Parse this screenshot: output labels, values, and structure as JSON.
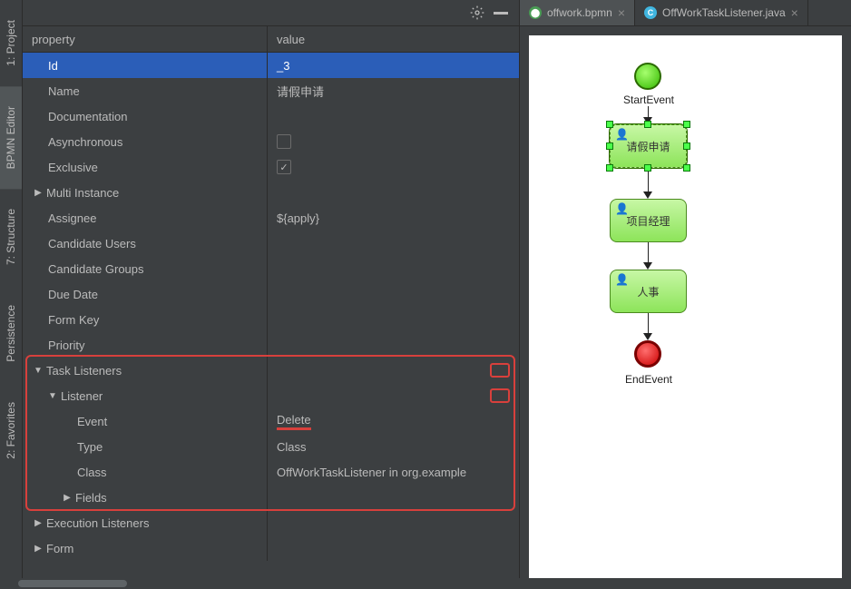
{
  "toolstrip": {
    "items": [
      {
        "label": "1: Project"
      },
      {
        "label": "BPMN Editor"
      },
      {
        "label": "7: Structure"
      },
      {
        "label": "Persistence"
      },
      {
        "label": "2: Favorites"
      }
    ]
  },
  "props": {
    "header_property": "property",
    "header_value": "value",
    "rows": {
      "id_label": "Id",
      "id_value": "_3",
      "name_label": "Name",
      "name_value": "请假申请",
      "doc_label": "Documentation",
      "async_label": "Asynchronous",
      "excl_label": "Exclusive",
      "excl_checked": "✓",
      "multi_label": "Multi Instance",
      "assignee_label": "Assignee",
      "assignee_value": "${apply}",
      "cand_users_label": "Candidate Users",
      "cand_groups_label": "Candidate Groups",
      "due_label": "Due Date",
      "formkey_label": "Form Key",
      "priority_label": "Priority",
      "tasklisteners_label": "Task Listeners",
      "listener_label": "Listener",
      "event_label": "Event",
      "event_value": "Delete",
      "type_label": "Type",
      "type_value": "Class",
      "class_label": "Class",
      "class_value": "OffWorkTaskListener in org.example",
      "fields_label": "Fields",
      "execlisteners_label": "Execution Listeners",
      "form_label": "Form"
    }
  },
  "tabs": {
    "items": [
      {
        "label": "offwork.bpmn"
      },
      {
        "label": "OffWorkTaskListener.java"
      }
    ]
  },
  "diagram": {
    "start_label": "StartEvent",
    "task1": "请假申请",
    "task2": "项目经理",
    "task3": "人事",
    "end_label": "EndEvent"
  },
  "chart_data": {
    "type": "diagram",
    "nodes": [
      {
        "id": "start",
        "type": "startEvent",
        "label": "StartEvent"
      },
      {
        "id": "t1",
        "type": "userTask",
        "label": "请假申请",
        "selected": true
      },
      {
        "id": "t2",
        "type": "userTask",
        "label": "项目经理"
      },
      {
        "id": "t3",
        "type": "userTask",
        "label": "人事"
      },
      {
        "id": "end",
        "type": "endEvent",
        "label": "EndEvent"
      }
    ],
    "edges": [
      {
        "from": "start",
        "to": "t1"
      },
      {
        "from": "t1",
        "to": "t2"
      },
      {
        "from": "t2",
        "to": "t3"
      },
      {
        "from": "t3",
        "to": "end"
      }
    ]
  }
}
